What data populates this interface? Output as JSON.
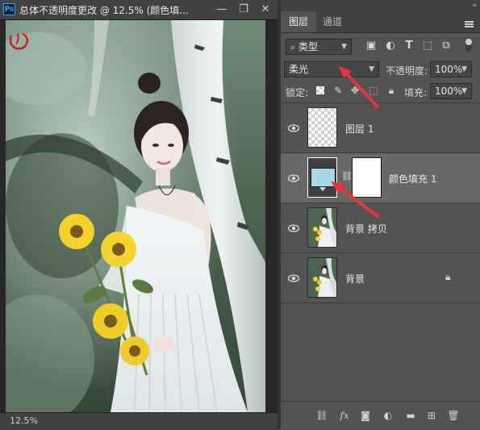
{
  "document": {
    "title": "总体不透明度更改 @ 12.5% (颜色填...",
    "app_badge": "Ps",
    "window_controls": {
      "minimize": "—",
      "restore": "❐",
      "close": "✕"
    },
    "status_zoom": "12.5%"
  },
  "panel": {
    "tabs": [
      {
        "label": "图层"
      },
      {
        "label": "通道"
      }
    ],
    "filter": {
      "kind_label": "类型"
    },
    "blend": {
      "mode": "柔光",
      "opacity_label": "不透明度:",
      "opacity_value": "100%"
    },
    "lock": {
      "label": "锁定:",
      "fill_label": "填充:",
      "fill_value": "100%"
    },
    "layers": [
      {
        "name": "图层 1",
        "visible": true,
        "thumbnail": "transparent"
      },
      {
        "name": "颜色填充 1",
        "visible": true,
        "thumbnail": "color-fill",
        "fill_color": "#a8d8e6",
        "active": true
      },
      {
        "name": "背景 拷贝",
        "visible": true,
        "thumbnail": "photo"
      },
      {
        "name": "背景",
        "visible": true,
        "thumbnail": "photo",
        "locked": true
      }
    ],
    "bottom_icons": [
      "link-icon",
      "fx-icon",
      "mask-icon",
      "adjustment-icon",
      "group-folder-icon",
      "new-layer-icon",
      "trash-icon"
    ],
    "bottom_labels": {
      "fx": "fx"
    }
  },
  "colors": {
    "panel_bg": "#535353",
    "selected_row": "#676767",
    "annotation_arrow": "#e8343a",
    "fill_swatch": "#a8d8e6"
  }
}
